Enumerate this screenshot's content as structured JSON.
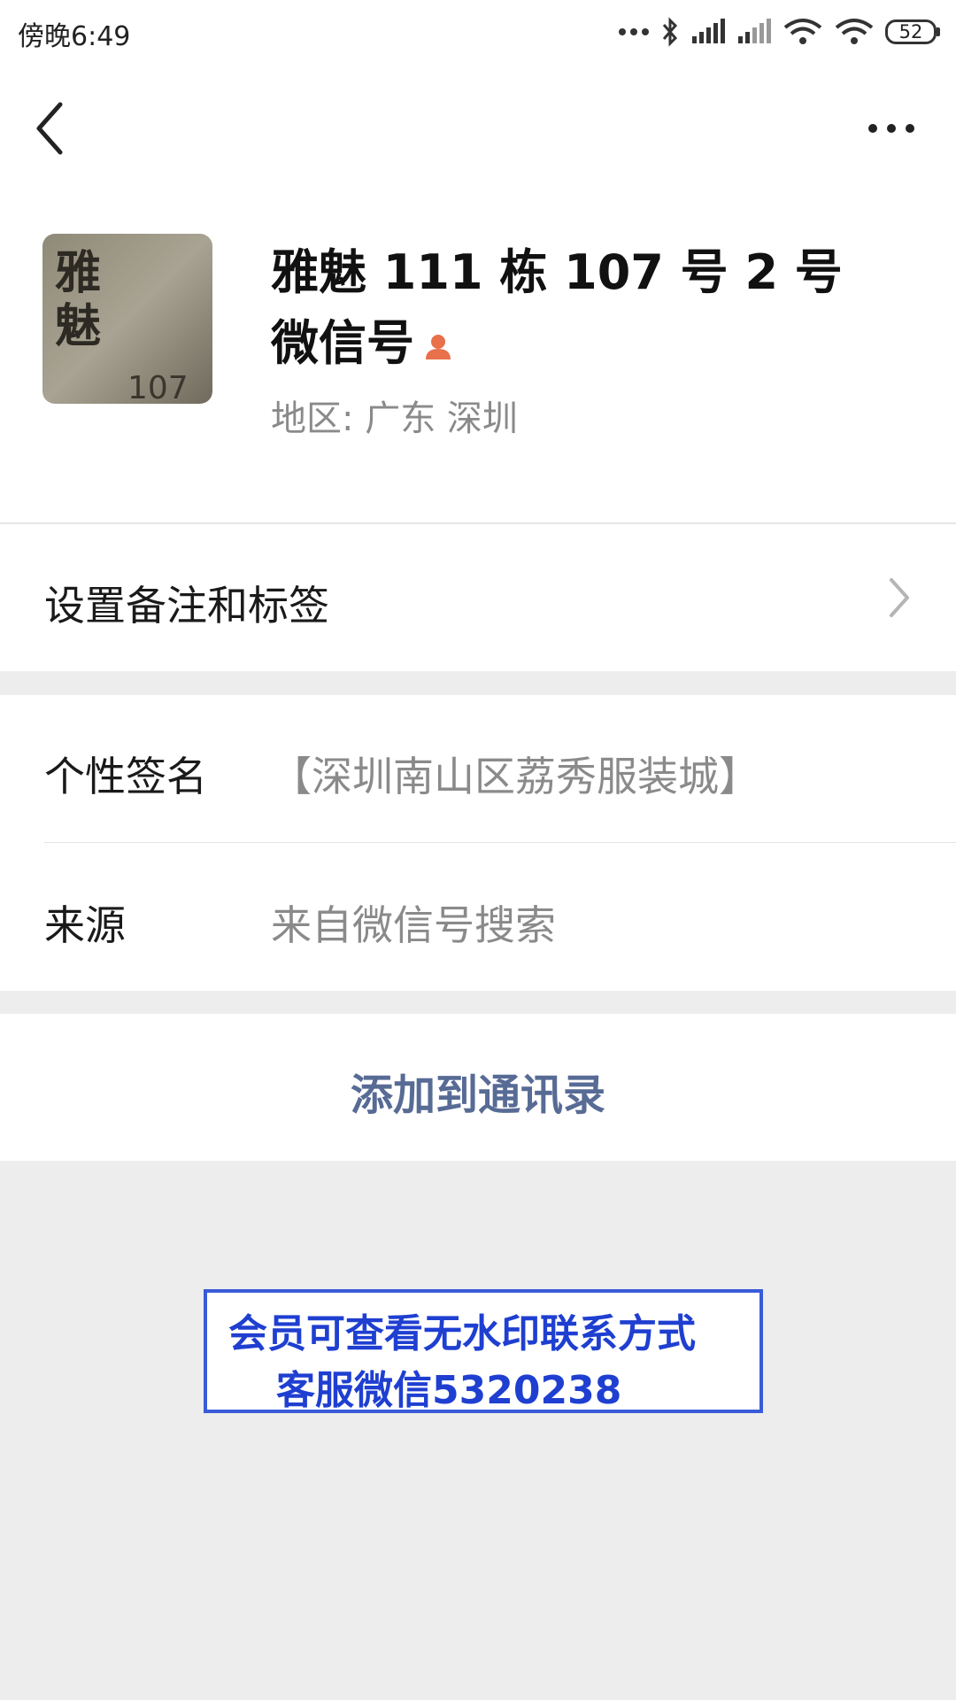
{
  "status_bar": {
    "time": "傍晚6:49",
    "battery": "52"
  },
  "profile": {
    "name": "雅魅 111 栋 107 号 2 号微信号",
    "region": "地区:  广东  深圳",
    "avatar": {
      "text_top": "雅",
      "text_mid": "魅",
      "text_bottom": "107"
    }
  },
  "rows": {
    "remark_label": "设置备注和标签",
    "signature_label": "个性签名",
    "signature_value": "【深圳南山区荔秀服装城】",
    "source_label": "来源",
    "source_value": "来自微信号搜索"
  },
  "actions": {
    "add_contact": "添加到通讯录"
  },
  "watermark": {
    "line1": "会员可查看无水印联系方式",
    "line2": "客服微信5320238"
  },
  "colors": {
    "link": "#576b95",
    "watermark": "#1f3fd1",
    "background": "#ededed"
  }
}
